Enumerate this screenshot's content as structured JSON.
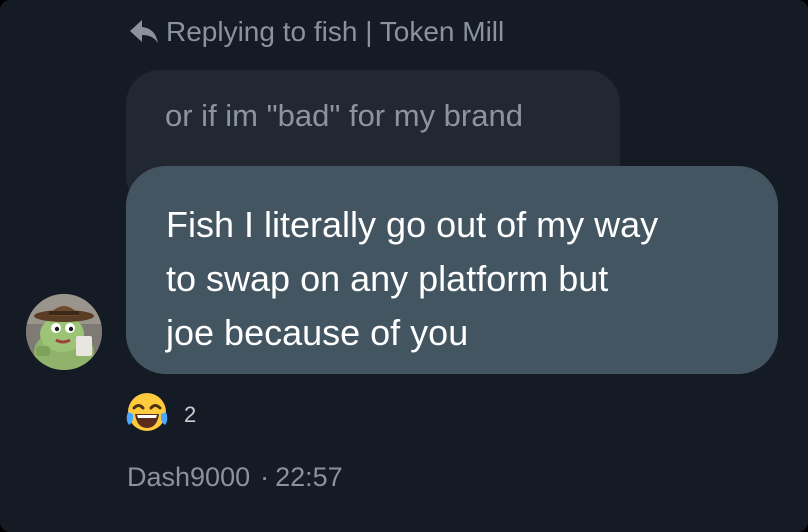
{
  "reply": {
    "icon": "reply-arrow-icon",
    "text": "Replying to fish | Token Mill"
  },
  "quoted_message": {
    "text": "or if im \"bad\" for my brand"
  },
  "message": {
    "lines": [
      "Fish I literally go out of my way",
      "to swap on any platform but",
      "joe because of you"
    ]
  },
  "reaction": {
    "icon": "laughing-crying-emoji-icon",
    "count": "2"
  },
  "meta": {
    "author": "Dash9000",
    "separator": "·",
    "time": "22:57"
  },
  "colors": {
    "background": "#151b24",
    "bubble": "#445562",
    "quoted_bubble": "#222831",
    "muted_text": "#8b929c"
  }
}
